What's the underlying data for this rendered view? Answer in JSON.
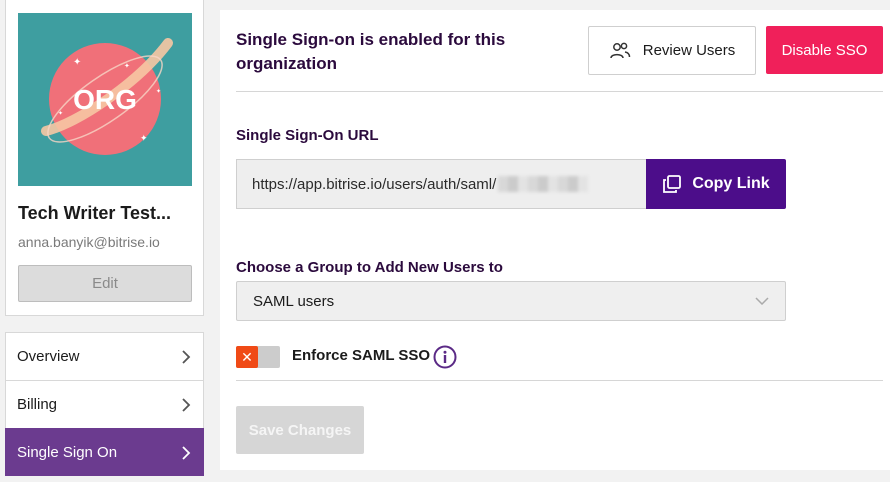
{
  "org": {
    "logo_text": "ORG",
    "name": "Tech Writer Test...",
    "email": "anna.banyik@bitrise.io",
    "edit_label": "Edit"
  },
  "nav": {
    "items": [
      {
        "label": "Overview",
        "active": false
      },
      {
        "label": "Billing",
        "active": false
      },
      {
        "label": "Single Sign On",
        "active": true
      }
    ]
  },
  "header": {
    "status": "Single Sign-on is enabled for this organization",
    "review_users_label": "Review Users",
    "disable_sso_label": "Disable SSO"
  },
  "sso_url": {
    "label": "Single Sign-On URL",
    "value": "https://app.bitrise.io/users/auth/saml/",
    "copy_label": "Copy Link"
  },
  "group": {
    "label": "Choose a Group to Add New Users to",
    "selected": "SAML users"
  },
  "enforce": {
    "label": "Enforce SAML SSO",
    "enabled": false
  },
  "save_label": "Save Changes",
  "colors": {
    "accent_purple": "#4c0d8a",
    "nav_active": "#6b3b8f",
    "danger": "#f0205a",
    "avatar_bg": "#3e9ea0",
    "avatar_circle": "#f07079"
  },
  "icons": {
    "review": "users-icon",
    "copy": "copy-icon",
    "chevron": "chevron-right-icon",
    "select": "chevron-down-icon",
    "info": "info-icon",
    "toggle": "close-icon"
  }
}
